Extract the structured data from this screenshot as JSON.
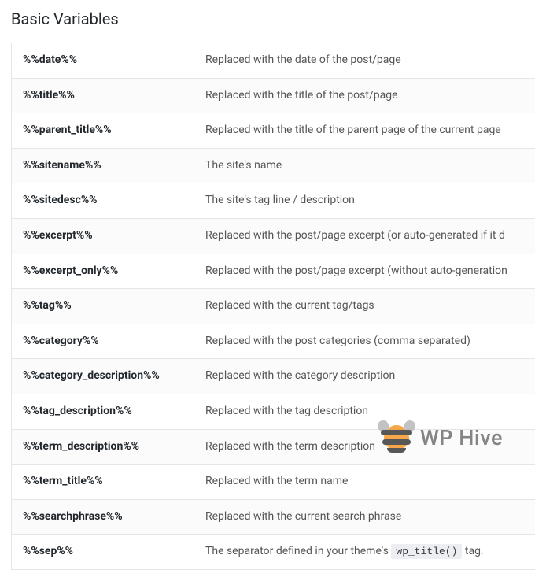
{
  "heading": "Basic Variables",
  "rows": [
    {
      "var": "%%date%%",
      "desc": "Replaced with the date of the post/page"
    },
    {
      "var": "%%title%%",
      "desc": "Replaced with the title of the post/page"
    },
    {
      "var": "%%parent_title%%",
      "desc": "Replaced with the title of the parent page of the current page"
    },
    {
      "var": "%%sitename%%",
      "desc": "The site's name"
    },
    {
      "var": "%%sitedesc%%",
      "desc": "The site's tag line / description"
    },
    {
      "var": "%%excerpt%%",
      "desc": "Replaced with the post/page excerpt (or auto-generated if it d"
    },
    {
      "var": "%%excerpt_only%%",
      "desc": "Replaced with the post/page excerpt (without auto-generation"
    },
    {
      "var": "%%tag%%",
      "desc": "Replaced with the current tag/tags"
    },
    {
      "var": "%%category%%",
      "desc": "Replaced with the post categories (comma separated)"
    },
    {
      "var": "%%category_description%%",
      "desc": "Replaced with the category description"
    },
    {
      "var": "%%tag_description%%",
      "desc": "Replaced with the tag description"
    },
    {
      "var": "%%term_description%%",
      "desc": "Replaced with the term description"
    },
    {
      "var": "%%term_title%%",
      "desc": "Replaced with the term name"
    },
    {
      "var": "%%searchphrase%%",
      "desc": "Replaced with the current search phrase"
    },
    {
      "var": "%%sep%%",
      "desc_pre": "The separator defined in your theme's ",
      "code": "wp_title()",
      "desc_post": " tag."
    }
  ],
  "watermark": {
    "text": "WP Hive"
  }
}
